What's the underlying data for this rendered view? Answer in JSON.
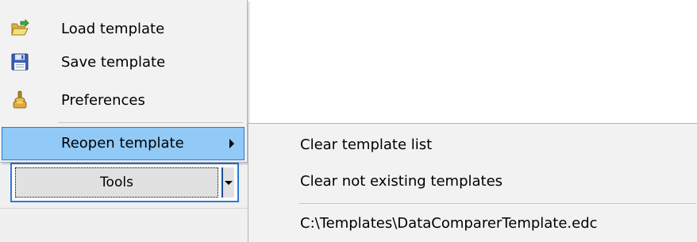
{
  "menu": {
    "items": [
      {
        "label": "Load template",
        "icon": "folder-open-icon"
      },
      {
        "label": "Save template",
        "icon": "floppy-disk-icon"
      },
      {
        "label": "Preferences",
        "icon": "joystick-settings-icon"
      }
    ],
    "reopen": {
      "label": "Reopen template",
      "icon": "chevron-right-icon"
    }
  },
  "submenu": {
    "clear_list": "Clear template list",
    "clear_missing": "Clear not existing templates",
    "recent": [
      "C:\\Templates\\DataComparerTemplate.edc"
    ]
  },
  "toolbar": {
    "tools_label": "Tools"
  },
  "colors": {
    "highlight": "#91c9f7",
    "accent": "#2c7ad6",
    "menu_bg": "#f2f2f2"
  }
}
